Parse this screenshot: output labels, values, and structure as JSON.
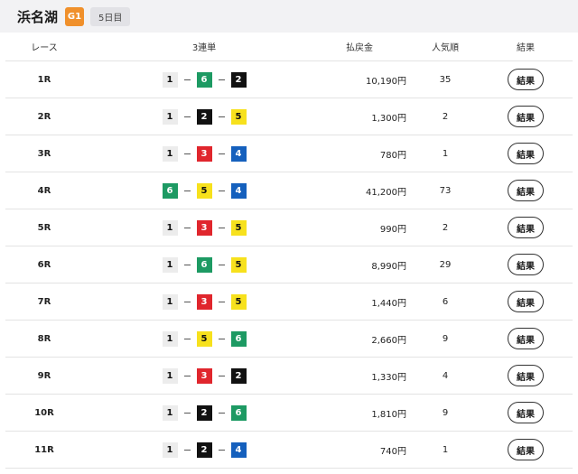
{
  "header": {
    "venue": "浜名湖",
    "grade": "G1",
    "day": "5日目"
  },
  "colors": {
    "boat_1": "#ececec",
    "boat_2": "#111111",
    "boat_3": "#e0262d",
    "boat_4": "#1560bd",
    "boat_5": "#f7e11d",
    "boat_6": "#1d9a63",
    "grade_badge": "#f0902b"
  },
  "table": {
    "columns": {
      "race": "レース",
      "combo": "3連単",
      "payout": "払戻金",
      "popularity": "人気順",
      "result": "結果"
    },
    "rows": [
      {
        "race": "1R",
        "combo": [
          "1",
          "6",
          "2"
        ],
        "payout": "10,190円",
        "popularity": "35",
        "result": "結果"
      },
      {
        "race": "2R",
        "combo": [
          "1",
          "2",
          "5"
        ],
        "payout": "1,300円",
        "popularity": "2",
        "result": "結果"
      },
      {
        "race": "3R",
        "combo": [
          "1",
          "3",
          "4"
        ],
        "payout": "780円",
        "popularity": "1",
        "result": "結果"
      },
      {
        "race": "4R",
        "combo": [
          "6",
          "5",
          "4"
        ],
        "payout": "41,200円",
        "popularity": "73",
        "result": "結果"
      },
      {
        "race": "5R",
        "combo": [
          "1",
          "3",
          "5"
        ],
        "payout": "990円",
        "popularity": "2",
        "result": "結果"
      },
      {
        "race": "6R",
        "combo": [
          "1",
          "6",
          "5"
        ],
        "payout": "8,990円",
        "popularity": "29",
        "result": "結果"
      },
      {
        "race": "7R",
        "combo": [
          "1",
          "3",
          "5"
        ],
        "payout": "1,440円",
        "popularity": "6",
        "result": "結果"
      },
      {
        "race": "8R",
        "combo": [
          "1",
          "5",
          "6"
        ],
        "payout": "2,660円",
        "popularity": "9",
        "result": "結果"
      },
      {
        "race": "9R",
        "combo": [
          "1",
          "3",
          "2"
        ],
        "payout": "1,330円",
        "popularity": "4",
        "result": "結果"
      },
      {
        "race": "10R",
        "combo": [
          "1",
          "2",
          "6"
        ],
        "payout": "1,810円",
        "popularity": "9",
        "result": "結果"
      },
      {
        "race": "11R",
        "combo": [
          "1",
          "2",
          "4"
        ],
        "payout": "740円",
        "popularity": "1",
        "result": "結果"
      }
    ]
  }
}
